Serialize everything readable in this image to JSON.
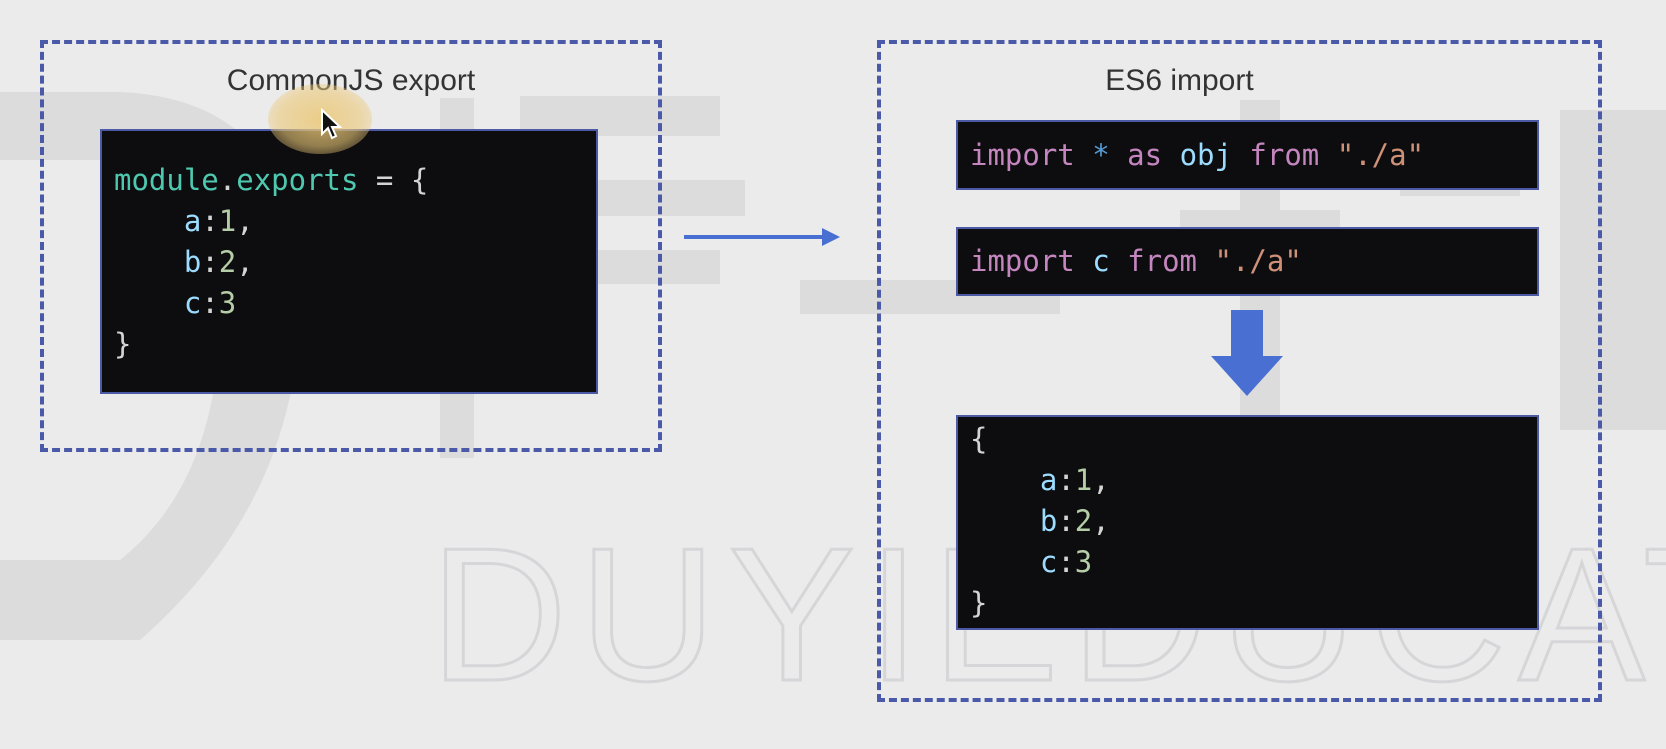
{
  "watermark": {
    "text": "DUYIEDUCATI"
  },
  "left_panel": {
    "title": "CommonJS export",
    "code": {
      "line1_obj": "module",
      "line1_dot": ".",
      "line1_prop": "exports",
      "line1_rest": " = {",
      "line2_key": "a",
      "line2_colon": ":",
      "line2_val": "1",
      "line2_comma": ",",
      "line3_key": "b",
      "line3_colon": ":",
      "line3_val": "2",
      "line3_comma": ",",
      "line4_key": "c",
      "line4_colon": ":",
      "line4_val": "3",
      "line5": "}"
    }
  },
  "right_panel": {
    "title": "ES6 import",
    "import1": {
      "kw1": "import",
      "star": "*",
      "kw2": "as",
      "name": "obj",
      "kw3": "from",
      "path": "\"./a\""
    },
    "import2": {
      "kw1": "import",
      "name": "c",
      "kw3": "from",
      "path": "\"./a\""
    },
    "result": {
      "open": "{",
      "line2_key": "a",
      "line2_colon": ":",
      "line2_val": "1",
      "line2_comma": ",",
      "line3_key": "b",
      "line3_colon": ":",
      "line3_val": "2",
      "line3_comma": ",",
      "line4_key": "c",
      "line4_colon": ":",
      "line4_val": "3",
      "close": "}"
    }
  },
  "colors": {
    "dashed_border": "#4b5aa8",
    "arrow": "#4a6fd3",
    "code_bg": "#0d0d0f"
  },
  "icons": {
    "arrow_right": "arrow-right-icon",
    "arrow_down": "arrow-down-icon",
    "cursor": "mouse-cursor-icon"
  }
}
